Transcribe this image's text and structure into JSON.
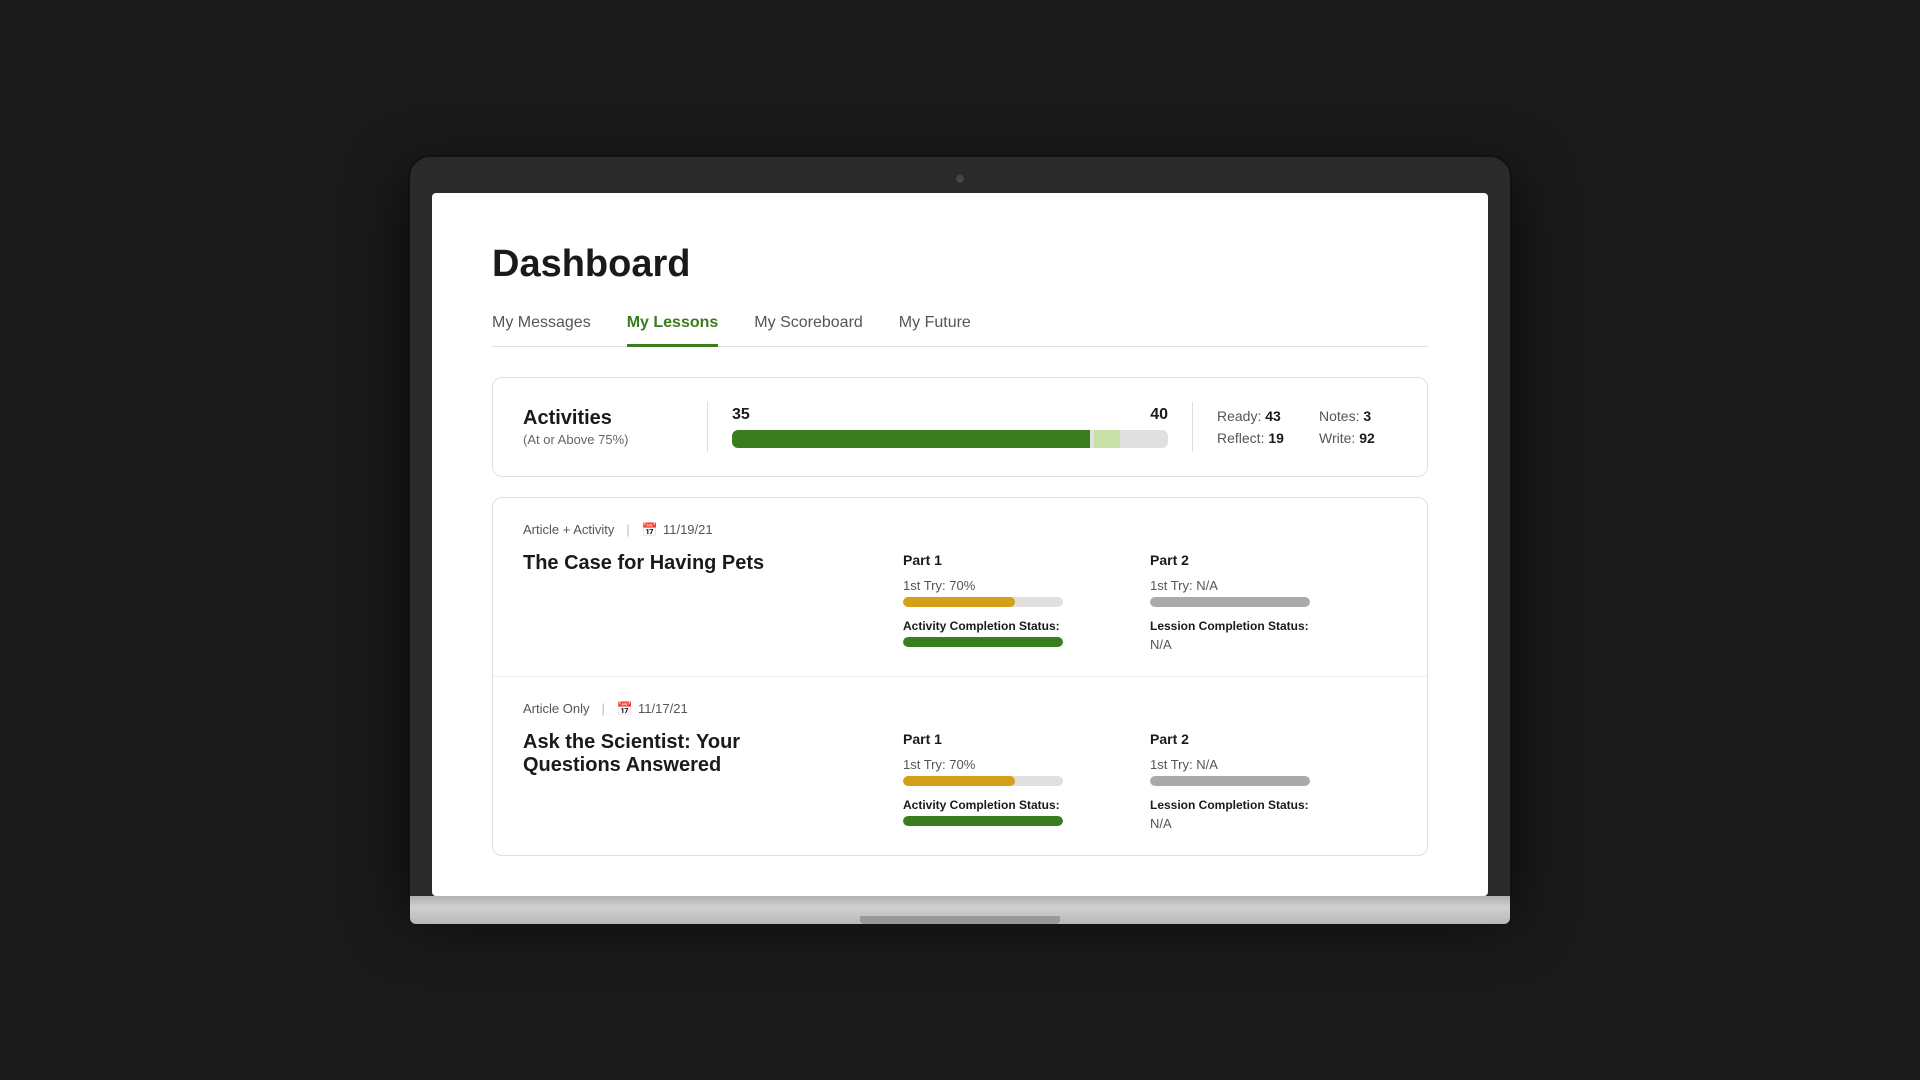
{
  "page": {
    "title": "Dashboard"
  },
  "tabs": [
    {
      "id": "messages",
      "label": "My Messages",
      "active": false
    },
    {
      "id": "lessons",
      "label": "My Lessons",
      "active": true
    },
    {
      "id": "scoreboard",
      "label": "My Scoreboard",
      "active": false
    },
    {
      "id": "future",
      "label": "My Future",
      "active": false
    }
  ],
  "activities": {
    "label": "Activities",
    "sublabel": "(At or Above 75%)",
    "current": "35",
    "total": "40",
    "progress_percent": 82,
    "progress_light_percent": 6,
    "stats": [
      {
        "label": "Ready:",
        "value": "43"
      },
      {
        "label": "Notes:",
        "value": "3"
      },
      {
        "label": "Reflect:",
        "value": "19"
      },
      {
        "label": "Write:",
        "value": "92"
      }
    ]
  },
  "lessons": [
    {
      "type": "Article + Activity",
      "date": "11/19/21",
      "title": "The Case for Having Pets",
      "part1": {
        "label": "Part 1",
        "try_label": "1st Try: 70%",
        "try_fill": 70,
        "try_color": "yellow",
        "completion_label": "Activity Completion Status:",
        "completion_fill": 100,
        "completion_na": false
      },
      "part2": {
        "label": "Part 2",
        "try_label": "1st Try: N/A",
        "try_fill": 100,
        "try_color": "gray",
        "completion_label": "Lession Completion Status:",
        "completion_fill": 0,
        "completion_na": true,
        "na_text": "N/A"
      }
    },
    {
      "type": "Article Only",
      "date": "11/17/21",
      "title": "Ask the Scientist: Your Questions Answered",
      "part1": {
        "label": "Part 1",
        "try_label": "1st Try: 70%",
        "try_fill": 70,
        "try_color": "yellow",
        "completion_label": "Activity Completion Status:",
        "completion_fill": 100,
        "completion_na": false
      },
      "part2": {
        "label": "Part 2",
        "try_label": "1st Try: N/A",
        "try_fill": 100,
        "try_color": "gray",
        "completion_label": "Lession Completion Status:",
        "completion_fill": 0,
        "completion_na": true,
        "na_text": "N/A"
      }
    }
  ]
}
